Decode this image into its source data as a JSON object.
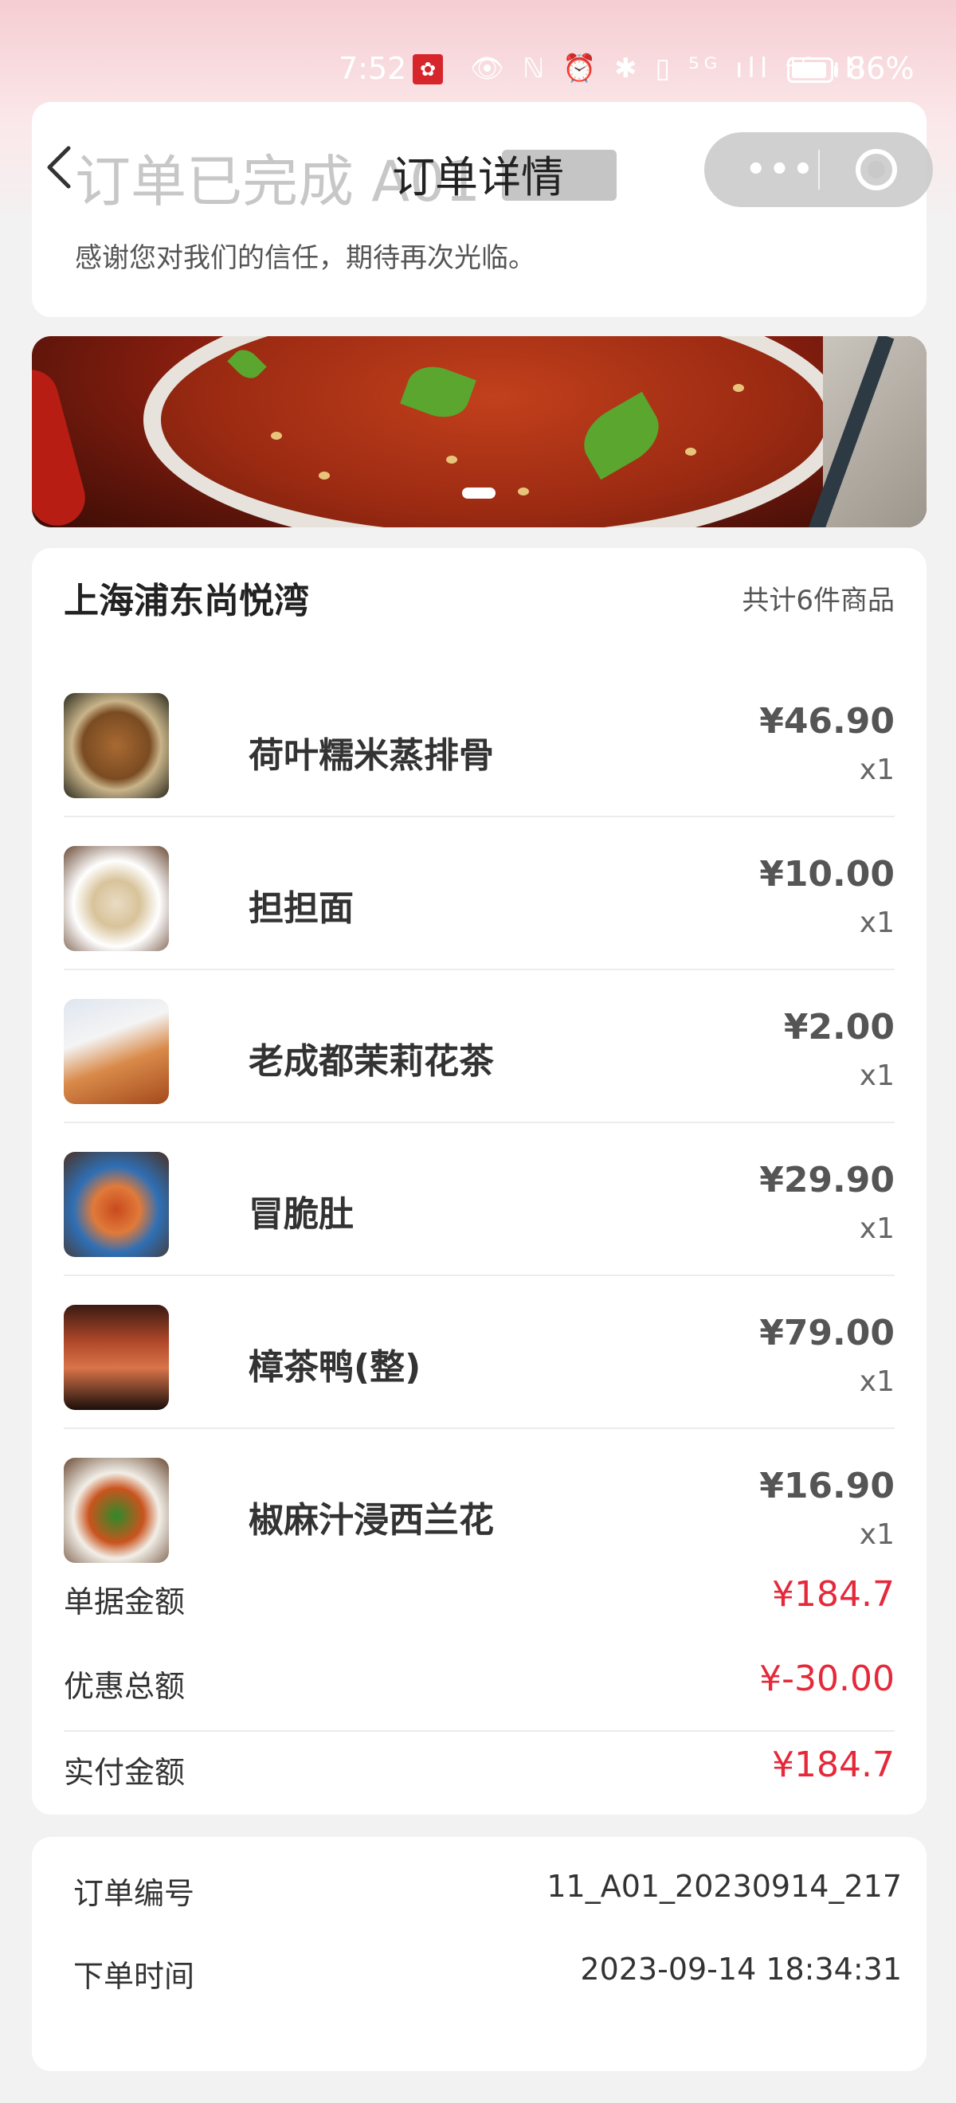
{
  "status_bar": {
    "time": "7:52",
    "app_icon": "notification-icon",
    "icons": "👁 ℕ ⏰ ✱ ▯ ⁵ᴳ ıll ⁴ᴳ ıll",
    "battery_percent": "86%",
    "battery_level": 0.86
  },
  "nav": {
    "title": "订单详情",
    "back_icon": "chevron-left-icon",
    "more_icon": "more-dots-icon",
    "close_icon": "target-circle-icon"
  },
  "status_card": {
    "title": "订单已完成 A01",
    "message": "感谢您对我们的信任，期待再次光临。"
  },
  "banner": {
    "image": "hot-pot-banner",
    "page_indicator_active": 1
  },
  "order": {
    "store_name": "上海浦东尚悦湾",
    "item_count_text": "共计6件商品",
    "items": [
      {
        "name": "荷叶糯米蒸排骨",
        "price": "¥46.90",
        "qty": "x1",
        "thumb": "steamed-ribs"
      },
      {
        "name": "担担面",
        "price": "¥10.00",
        "qty": "x1",
        "thumb": "dandan-noodles"
      },
      {
        "name": "老成都茉莉花茶",
        "price": "¥2.00",
        "qty": "x1",
        "thumb": "jasmine-tea"
      },
      {
        "name": "冒脆肚",
        "price": "¥29.90",
        "qty": "x1",
        "thumb": "spicy-tripe"
      },
      {
        "name": "樟茶鸭(整)",
        "price": "¥79.00",
        "qty": "x1",
        "thumb": "tea-smoked-duck"
      },
      {
        "name": "椒麻汁浸西兰花",
        "price": "¥16.90",
        "qty": "x1",
        "thumb": "pepper-broccoli"
      }
    ],
    "summary": {
      "bill_label": "单据金额",
      "bill_value": "¥184.7",
      "discount_label": "优惠总额",
      "discount_value": "¥-30.00",
      "paid_label": "实付金额",
      "paid_value": "¥184.7"
    }
  },
  "info": {
    "order_no_label": "订单编号",
    "order_no_value": "11_A01_20230914_217",
    "order_time_label": "下单时间",
    "order_time_value": "2023-09-14 18:34:31"
  },
  "colors": {
    "accent_red": "#e5293a",
    "header_pink": "#f5cdd2",
    "background": "#f2f2f2"
  }
}
